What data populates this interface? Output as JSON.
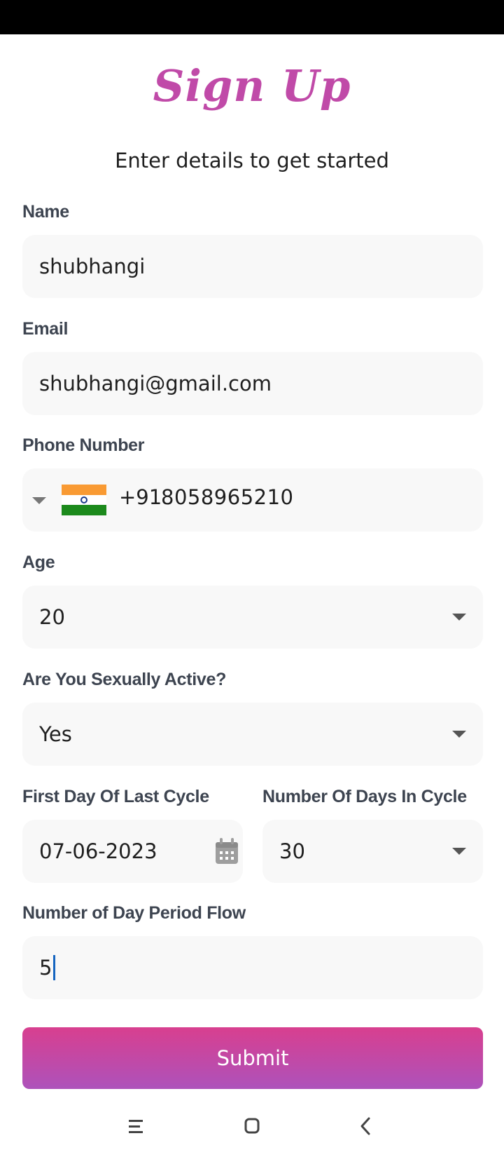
{
  "header": {
    "title": "Sign Up",
    "subtitle": "Enter details to get started"
  },
  "form": {
    "name": {
      "label": "Name",
      "value": "shubhangi"
    },
    "email": {
      "label": "Email",
      "value": "shubhangi@gmail.com"
    },
    "phone": {
      "label": "Phone Number",
      "country": "India",
      "dial_code": "+91",
      "value": "8058965210"
    },
    "age": {
      "label": "Age",
      "value": "20"
    },
    "sexually_active": {
      "label": "Are You Sexually Active?",
      "value": "Yes"
    },
    "last_cycle": {
      "label": "First Day Of Last Cycle",
      "value": "07-06-2023",
      "icon": "calendar-icon"
    },
    "cycle_days": {
      "label": "Number Of Days In Cycle",
      "value": "30"
    },
    "period_flow": {
      "label": "Number of Day Period Flow",
      "value": "5"
    },
    "submit_label": "Submit"
  },
  "colors": {
    "title": "#c04aa8",
    "submit_gradient_start": "#d83f8f",
    "submit_gradient_end": "#ad52bb",
    "field_background": "#f8f8f8"
  },
  "navbar": {
    "icons": [
      "recent-apps-icon",
      "home-icon",
      "back-icon"
    ]
  }
}
